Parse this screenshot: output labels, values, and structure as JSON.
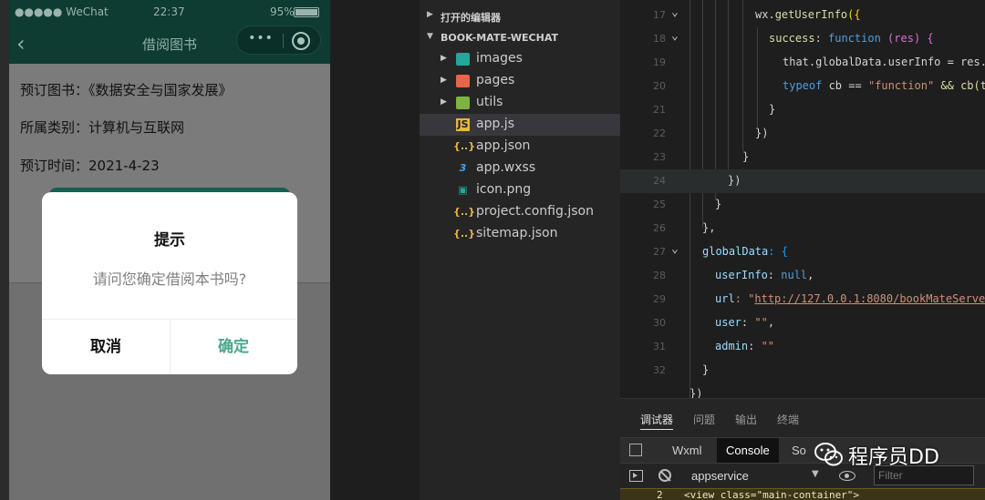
{
  "simulator": {
    "status": {
      "signal": "●●●●● WeChat",
      "time": "22:37",
      "battery": "95%"
    },
    "navbar": {
      "back": "‹",
      "title": "借阅图书",
      "menu": "•••"
    },
    "info": {
      "book": "预订图书：《数据安全与国家发展》",
      "category": "所属类别：计算机与互联网",
      "time": "预订时间：2021-4-23"
    },
    "modal": {
      "title": "提示",
      "message": "请问您确定借阅本书吗?",
      "cancel": "取消",
      "confirm": "确定"
    }
  },
  "explorer": {
    "open_editors": "打开的编辑器",
    "project": "BOOK-MATE-WECHAT",
    "items": [
      {
        "name": "images",
        "icon": "folder-images-icon",
        "glyph": "▪"
      },
      {
        "name": "pages",
        "icon": "folder-pages-icon",
        "glyph": "▪"
      },
      {
        "name": "utils",
        "icon": "folder-utils-icon",
        "glyph": "▪"
      },
      {
        "name": "app.js",
        "icon": "js-file-icon",
        "glyph": "JS"
      },
      {
        "name": "app.json",
        "icon": "json-file-icon",
        "glyph": "{..}"
      },
      {
        "name": "app.wxss",
        "icon": "css-file-icon",
        "glyph": "3"
      },
      {
        "name": "icon.png",
        "icon": "image-file-icon",
        "glyph": "▣"
      },
      {
        "name": "project.config.json",
        "icon": "json-file-icon",
        "glyph": "{..}"
      },
      {
        "name": "sitemap.json",
        "icon": "json-file-icon",
        "glyph": "{..}"
      }
    ]
  },
  "editor": {
    "line_numbers": [
      "17",
      "18",
      "19",
      "20",
      "21",
      "22",
      "23",
      "24",
      "25",
      "26",
      "27",
      "28",
      "29",
      "30",
      "31",
      "32"
    ],
    "code": {
      "l17a": "wx.",
      "l17b": "getUserInfo",
      "l17c": "({",
      "l18a": "success",
      "l18b": ": ",
      "l18c": "function",
      "l18d": " (res) {",
      "l19": "that.globalData.userInfo = res.",
      "l20a": "typeof",
      "l20b": " cb == ",
      "l20c": "\"function\"",
      "l20d": " && cb(t",
      "l21": "}",
      "l22": "})",
      "l23": "}",
      "l24": "})",
      "l25": "}",
      "l26": "},",
      "l27a": "globalData",
      "l27b": ": {",
      "l28a": "userInfo",
      "l28b": ": ",
      "l28c": "null",
      "l28d": ",",
      "l29a": "url",
      "l29b": ": \"",
      "l29c": "http://127.0.0.1:8080/bookMateServe",
      "l30a": "user",
      "l30b": ": ",
      "l30c": "\"\"",
      "l30d": ",",
      "l31a": "admin",
      "l31b": ": ",
      "l31c": "\"\"",
      "l32": "}",
      "l33": "})"
    }
  },
  "debug": {
    "tabs": [
      "调试器",
      "问题",
      "输出",
      "终端"
    ],
    "devtools_tabs": [
      "Wxml",
      "Console",
      "So"
    ],
    "context": "appservice",
    "filter_placeholder": "Filter",
    "console_line_num": "2",
    "console_line_code": "<view class=\"main-container\">"
  },
  "watermark": {
    "text": "程序员DD"
  }
}
